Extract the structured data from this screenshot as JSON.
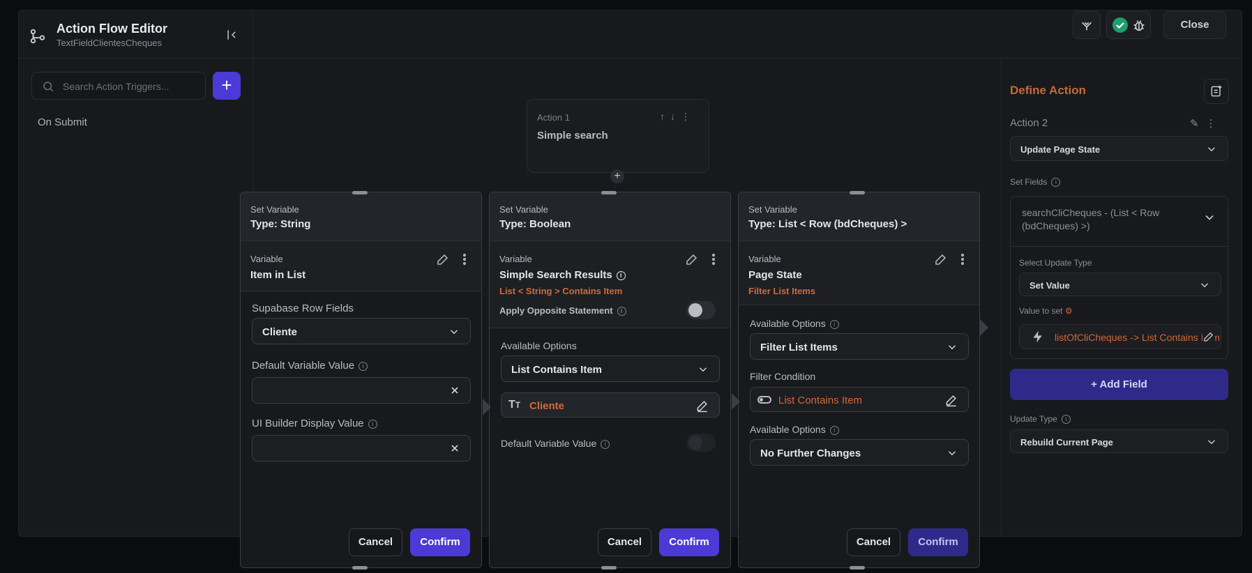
{
  "editor": {
    "title": "Action Flow Editor",
    "subtitle": "TextFieldClientesCheques",
    "close_label": "Close"
  },
  "triggers": {
    "search_placeholder": "Search Action Triggers...",
    "add_label": "+",
    "items": [
      "On Submit"
    ]
  },
  "canvas": {
    "node_label": "Action 1",
    "node_name": "Simple search",
    "add_label": "+"
  },
  "define": {
    "title": "Define Action",
    "action_label": "Action 2",
    "action_type": "Update Page State",
    "set_fields_label": "Set Fields",
    "field_name": "searchCliCheques - (List < Row (bdCheques) >)",
    "update_type_label": "Select Update Type",
    "update_type_value": "Set Value",
    "value_to_set_label": "Value to set",
    "value_to_set": "listOfCliCheques -> List Contains Item",
    "add_field_label": "+  Add Field",
    "page_update_label": "Update Type",
    "page_update_value": "Rebuild Current Page"
  },
  "dialogs": [
    {
      "header_a": "Set Variable",
      "header_b": "Type: String",
      "var_label": "Variable",
      "var_name": "Item in List",
      "field1_label": "Supabase Row Fields",
      "field1_value": "Cliente",
      "field2_label": "Default Variable Value",
      "field3_label": "UI Builder Display Value",
      "cancel": "Cancel",
      "confirm": "Confirm"
    },
    {
      "header_a": "Set Variable",
      "header_b": "Type: Boolean",
      "var_label": "Variable",
      "var_name": "Simple Search Results",
      "var_sub": "List < String > Contains Item",
      "opposite_label": "Apply Opposite Statement",
      "options_label": "Available Options",
      "options_value": "List Contains Item",
      "chip_value": "Cliente",
      "default_label": "Default Variable Value",
      "cancel": "Cancel",
      "confirm": "Confirm"
    },
    {
      "header_a": "Set Variable",
      "header_b": "Type: List < Row (bdCheques) >",
      "var_label": "Variable",
      "var_name": "Page State",
      "var_sub": "Filter List Items",
      "options1_label": "Available Options",
      "options1_value": "Filter List Items",
      "filter_label": "Filter Condition",
      "filter_value": "List Contains Item",
      "options2_label": "Available Options",
      "options2_value": "No Further Changes",
      "cancel": "Cancel",
      "confirm": "Confirm"
    }
  ],
  "colors": {
    "accent": "#4b3ad6",
    "orange": "#cf6a3b",
    "background": "#17191c"
  }
}
